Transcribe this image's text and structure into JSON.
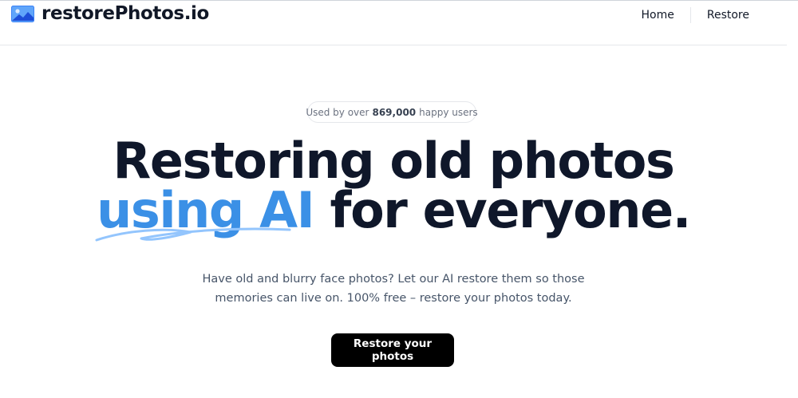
{
  "header": {
    "brand_name": "restorePhotos.io",
    "nav": [
      {
        "label": "Home"
      },
      {
        "label": "Restore"
      }
    ]
  },
  "hero": {
    "badge": {
      "prefix": "Used by over",
      "count": "869,000",
      "suffix": "happy users"
    },
    "title_line1": "Restoring old photos",
    "title_accent": "using AI",
    "title_rest": "for everyone.",
    "subtitle": "Have old and blurry face photos? Let our AI restore them so those memories can live on. 100% free – restore your photos today.",
    "cta_label": "Restore your photos"
  },
  "colors": {
    "accent": "#3b90e6",
    "text_dark": "#0f172a",
    "cta_background": "#000000"
  }
}
